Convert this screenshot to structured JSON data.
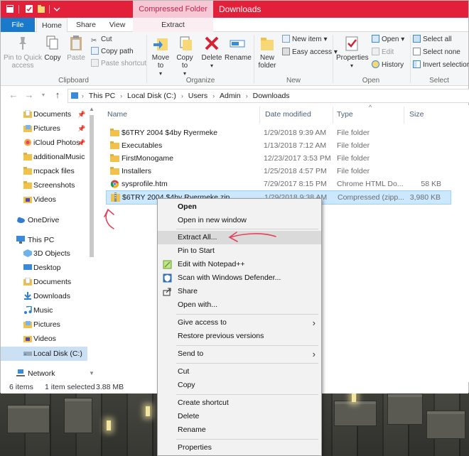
{
  "window": {
    "context_tab": "Compressed Folder Tools",
    "title": "Downloads"
  },
  "ribbon_tabs": {
    "file": "File",
    "home": "Home",
    "share": "Share",
    "view": "View",
    "extract": "Extract"
  },
  "ribbon": {
    "clipboard": {
      "pin": "Pin to Quick access",
      "copy": "Copy",
      "paste": "Paste",
      "cut": "Cut",
      "copy_path": "Copy path",
      "paste_shortcut": "Paste shortcut",
      "label": "Clipboard"
    },
    "organize": {
      "move_to": "Move to",
      "copy_to": "Copy to",
      "delete": "Delete",
      "rename": "Rename",
      "label": "Organize"
    },
    "new": {
      "new_folder": "New folder",
      "new_item": "New item",
      "easy_access": "Easy access",
      "label": "New"
    },
    "open": {
      "properties": "Properties",
      "open": "Open",
      "edit": "Edit",
      "history": "History",
      "label": "Open"
    },
    "select": {
      "select_all": "Select all",
      "select_none": "Select none",
      "invert": "Invert selection",
      "label": "Select"
    }
  },
  "address": {
    "crumbs": [
      "This PC",
      "Local Disk (C:)",
      "Users",
      "Admin",
      "Downloads"
    ]
  },
  "nav": {
    "items": [
      {
        "label": "Documents",
        "pinned": true
      },
      {
        "label": "Pictures",
        "pinned": true
      },
      {
        "label": "iCloud Photos",
        "pinned": true
      },
      {
        "label": "additionalMusic"
      },
      {
        "label": "mcpack files"
      },
      {
        "label": "Screenshots"
      },
      {
        "label": "Videos"
      },
      {
        "label": "OneDrive"
      },
      {
        "label": "This PC"
      },
      {
        "label": "3D Objects"
      },
      {
        "label": "Desktop"
      },
      {
        "label": "Documents"
      },
      {
        "label": "Downloads"
      },
      {
        "label": "Music"
      },
      {
        "label": "Pictures"
      },
      {
        "label": "Videos"
      },
      {
        "label": "Local Disk (C:)"
      },
      {
        "label": "Network"
      }
    ]
  },
  "columns": {
    "name": "Name",
    "date": "Date modified",
    "type": "Type",
    "size": "Size"
  },
  "files": [
    {
      "name": "$6TRY 2004 $4by Ryermeke",
      "date": "1/29/2018 9:39 AM",
      "type": "File folder",
      "size": ""
    },
    {
      "name": "Executables",
      "date": "1/13/2018 7:12 AM",
      "type": "File folder",
      "size": ""
    },
    {
      "name": "FirstMonogame",
      "date": "12/23/2017 3:53 PM",
      "type": "File folder",
      "size": ""
    },
    {
      "name": "Installers",
      "date": "1/25/2018 4:57 PM",
      "type": "File folder",
      "size": ""
    },
    {
      "name": "sysprofile.htm",
      "date": "7/29/2017 8:15 PM",
      "type": "Chrome HTML Do...",
      "size": "58 KB"
    },
    {
      "name": "$6TRY 2004 $4by Ryermeke.zip",
      "date": "1/29/2018 9:38 AM",
      "type": "Compressed (zipp...",
      "size": "3,980 KB"
    }
  ],
  "status": {
    "count": "6 items",
    "selected": "1 item selected",
    "size": "3.88 MB"
  },
  "context_menu": {
    "open": "Open",
    "open_new_window": "Open in new window",
    "extract_all": "Extract All...",
    "pin_start": "Pin to Start",
    "edit_notepad": "Edit with Notepad++",
    "scan_defender": "Scan with Windows Defender...",
    "share": "Share",
    "open_with": "Open with...",
    "give_access": "Give access to",
    "restore_versions": "Restore previous versions",
    "send_to": "Send to",
    "cut": "Cut",
    "copy": "Copy",
    "create_shortcut": "Create shortcut",
    "delete": "Delete",
    "rename": "Rename",
    "properties": "Properties"
  },
  "colors": {
    "title_bar": "#e3203a",
    "file_tab": "#1979ca",
    "selection": "#cce8ff",
    "folder": "#f0c24b",
    "annotation": "#e0435a"
  }
}
